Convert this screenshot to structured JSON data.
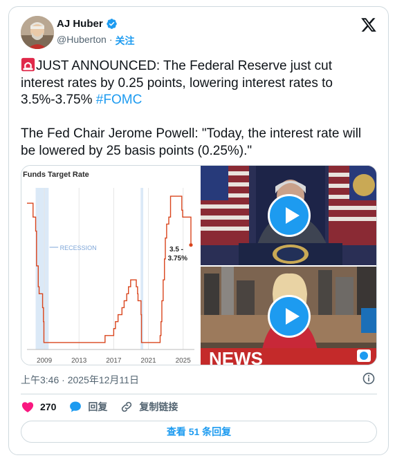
{
  "author": {
    "display_name": "AJ Huber",
    "handle": "@Huberton",
    "separator": "·",
    "follow_label": "关注"
  },
  "tweet": {
    "line1": "JUST ANNOUNCED: The Federal Reserve just cut interest rates by 0.25 points, lowering interest rates to 3.5%-3.75% ",
    "hashtag": "#FOMC",
    "line2": "The Fed Chair Jerome Powell: \"Today, the interest rate will be lowered by 25 basis points (0.25%).\""
  },
  "chart_data": {
    "type": "line",
    "title": "Funds Target Rate",
    "xlabel": "",
    "ylabel": "",
    "x_ticks": [
      "2009",
      "2013",
      "2017",
      "2021",
      "2025"
    ],
    "xlim": [
      2007,
      2026.3
    ],
    "ylim": [
      0,
      5.8
    ],
    "grid": "vertical",
    "annotations": [
      {
        "label": "RECESSION",
        "shaded_periods": [
          [
            2008.0,
            2009.5
          ],
          [
            2020.1,
            2020.4
          ]
        ]
      },
      {
        "label": "3.5 - 3.75%",
        "points_to": "last value"
      }
    ],
    "series": [
      {
        "color": "#d9441c",
        "x": [
          2007.0,
          2007.6,
          2007.7,
          2008.0,
          2008.1,
          2008.3,
          2008.4,
          2008.8,
          2008.9,
          2008.95,
          2015.9,
          2016.0,
          2016.9,
          2017.0,
          2017.2,
          2017.5,
          2017.95,
          2018.2,
          2018.5,
          2018.7,
          2018.95,
          2019.5,
          2019.6,
          2019.75,
          2019.8,
          2020.15,
          2020.2,
          2022.2,
          2022.35,
          2022.45,
          2022.55,
          2022.7,
          2022.85,
          2022.95,
          2023.1,
          2023.35,
          2023.55,
          2024.7,
          2024.85,
          2024.95,
          2025.9
        ],
        "y": [
          5.25,
          5.25,
          4.75,
          4.25,
          3.0,
          2.25,
          2.0,
          1.5,
          1.0,
          0.25,
          0.25,
          0.5,
          0.5,
          0.75,
          1.0,
          1.25,
          1.5,
          1.75,
          2.0,
          2.25,
          2.5,
          2.5,
          2.25,
          2.0,
          1.75,
          1.25,
          0.25,
          0.25,
          0.5,
          1.0,
          1.75,
          2.5,
          3.25,
          4.0,
          4.5,
          4.75,
          5.5,
          5.5,
          5.0,
          4.75,
          3.75
        ]
      }
    ],
    "end_marker": {
      "x": 2025.9,
      "y": 3.75
    }
  },
  "media": {
    "video1_caption": "",
    "video2_caption": "",
    "video2_ticker": "NEWS"
  },
  "timestamp": "上午3:46 · 2025年12月11日",
  "actions": {
    "like_count": "270",
    "reply_label": "回复",
    "copy_link_label": "复制链接"
  },
  "read_replies_label": "查看 51 条回复",
  "colors": {
    "accent": "#1d9bf0",
    "like": "#f91880",
    "chart_line": "#d9441c",
    "recession": "#dbe9f7"
  }
}
